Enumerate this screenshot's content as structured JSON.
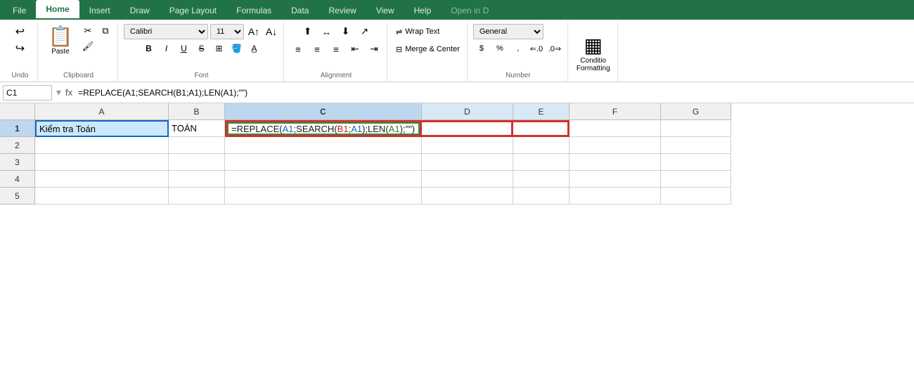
{
  "ribbon": {
    "tabs": [
      {
        "label": "File",
        "active": false
      },
      {
        "label": "Home",
        "active": true
      },
      {
        "label": "Insert",
        "active": false
      },
      {
        "label": "Draw",
        "active": false
      },
      {
        "label": "Page Layout",
        "active": false
      },
      {
        "label": "Formulas",
        "active": false
      },
      {
        "label": "Data",
        "active": false
      },
      {
        "label": "Review",
        "active": false
      },
      {
        "label": "View",
        "active": false
      },
      {
        "label": "Help",
        "active": false
      },
      {
        "label": "Open in D",
        "active": false
      }
    ],
    "undo_label": "Undo",
    "clipboard_label": "Clipboard",
    "paste_label": "Paste",
    "font_label": "Font",
    "font_name": "Calibri",
    "font_size": "11",
    "alignment_label": "Alignment",
    "wrap_text_label": "Wrap Text",
    "merge_center_label": "Merge & Center",
    "number_label": "Number",
    "number_format": "General",
    "conditional_label": "Conditio\nFormatting"
  },
  "formula_bar": {
    "cell_ref": "C1",
    "formula": "=REPLACE(A1;SEARCH(B1;A1);LEN(A1);\"\")"
  },
  "columns": [
    "A",
    "B",
    "C",
    "D",
    "E",
    "F",
    "G"
  ],
  "rows": [
    1,
    2,
    3,
    4,
    5
  ],
  "cells": {
    "A1": "Kiểm tra Toán",
    "B1": "TOÁN",
    "C1_formula": "=REPLACE(A1;SEARCH(B1;A1);LEN(A1);\"\")"
  }
}
